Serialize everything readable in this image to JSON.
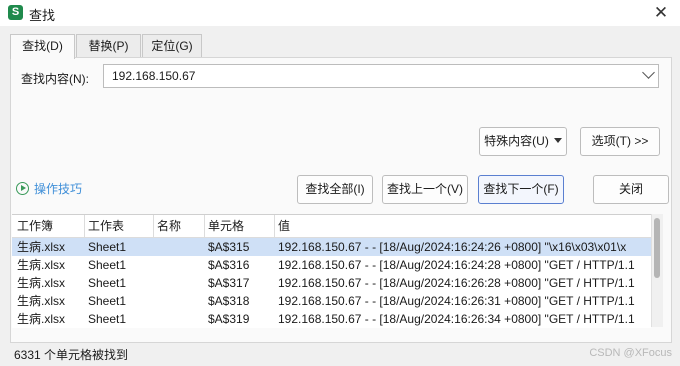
{
  "window": {
    "title": "查找",
    "app_icon_letter": "S"
  },
  "tabs": [
    {
      "label": "查找(D)",
      "active": true
    },
    {
      "label": "替换(P)",
      "active": false
    },
    {
      "label": "定位(G)",
      "active": false
    }
  ],
  "find": {
    "label": "查找内容(N):",
    "value": "192.168.150.67"
  },
  "buttons": {
    "special": "特殊内容(U)",
    "options": "选项(T) >>",
    "find_all": "查找全部(I)",
    "find_prev": "查找上一个(V)",
    "find_next": "查找下一个(F)",
    "close": "关闭"
  },
  "tips": {
    "label": "操作技巧"
  },
  "results": {
    "columns": [
      "工作簿",
      "工作表",
      "名称",
      "单元格",
      "值"
    ],
    "rows": [
      {
        "workbook": "生病.xlsx",
        "sheet": "Sheet1",
        "name": "",
        "cell": "$A$315",
        "value": "192.168.150.67 - - [18/Aug/2024:16:24:26 +0800] \"\\x16\\x03\\x01\\x",
        "selected": true
      },
      {
        "workbook": "生病.xlsx",
        "sheet": "Sheet1",
        "name": "",
        "cell": "$A$316",
        "value": "192.168.150.67 - - [18/Aug/2024:16:24:28 +0800] \"GET / HTTP/1.1",
        "selected": false
      },
      {
        "workbook": "生病.xlsx",
        "sheet": "Sheet1",
        "name": "",
        "cell": "$A$317",
        "value": "192.168.150.67 - - [18/Aug/2024:16:26:28 +0800] \"GET / HTTP/1.1",
        "selected": false
      },
      {
        "workbook": "生病.xlsx",
        "sheet": "Sheet1",
        "name": "",
        "cell": "$A$318",
        "value": "192.168.150.67 - - [18/Aug/2024:16:26:31 +0800] \"GET / HTTP/1.1",
        "selected": false
      },
      {
        "workbook": "生病.xlsx",
        "sheet": "Sheet1",
        "name": "",
        "cell": "$A$319",
        "value": "192.168.150.67 - - [18/Aug/2024:16:26:34 +0800] \"GET / HTTP/1.1",
        "selected": false
      }
    ]
  },
  "status": {
    "text": "6331 个单元格被找到"
  },
  "watermark": "CSDN @XFocus"
}
